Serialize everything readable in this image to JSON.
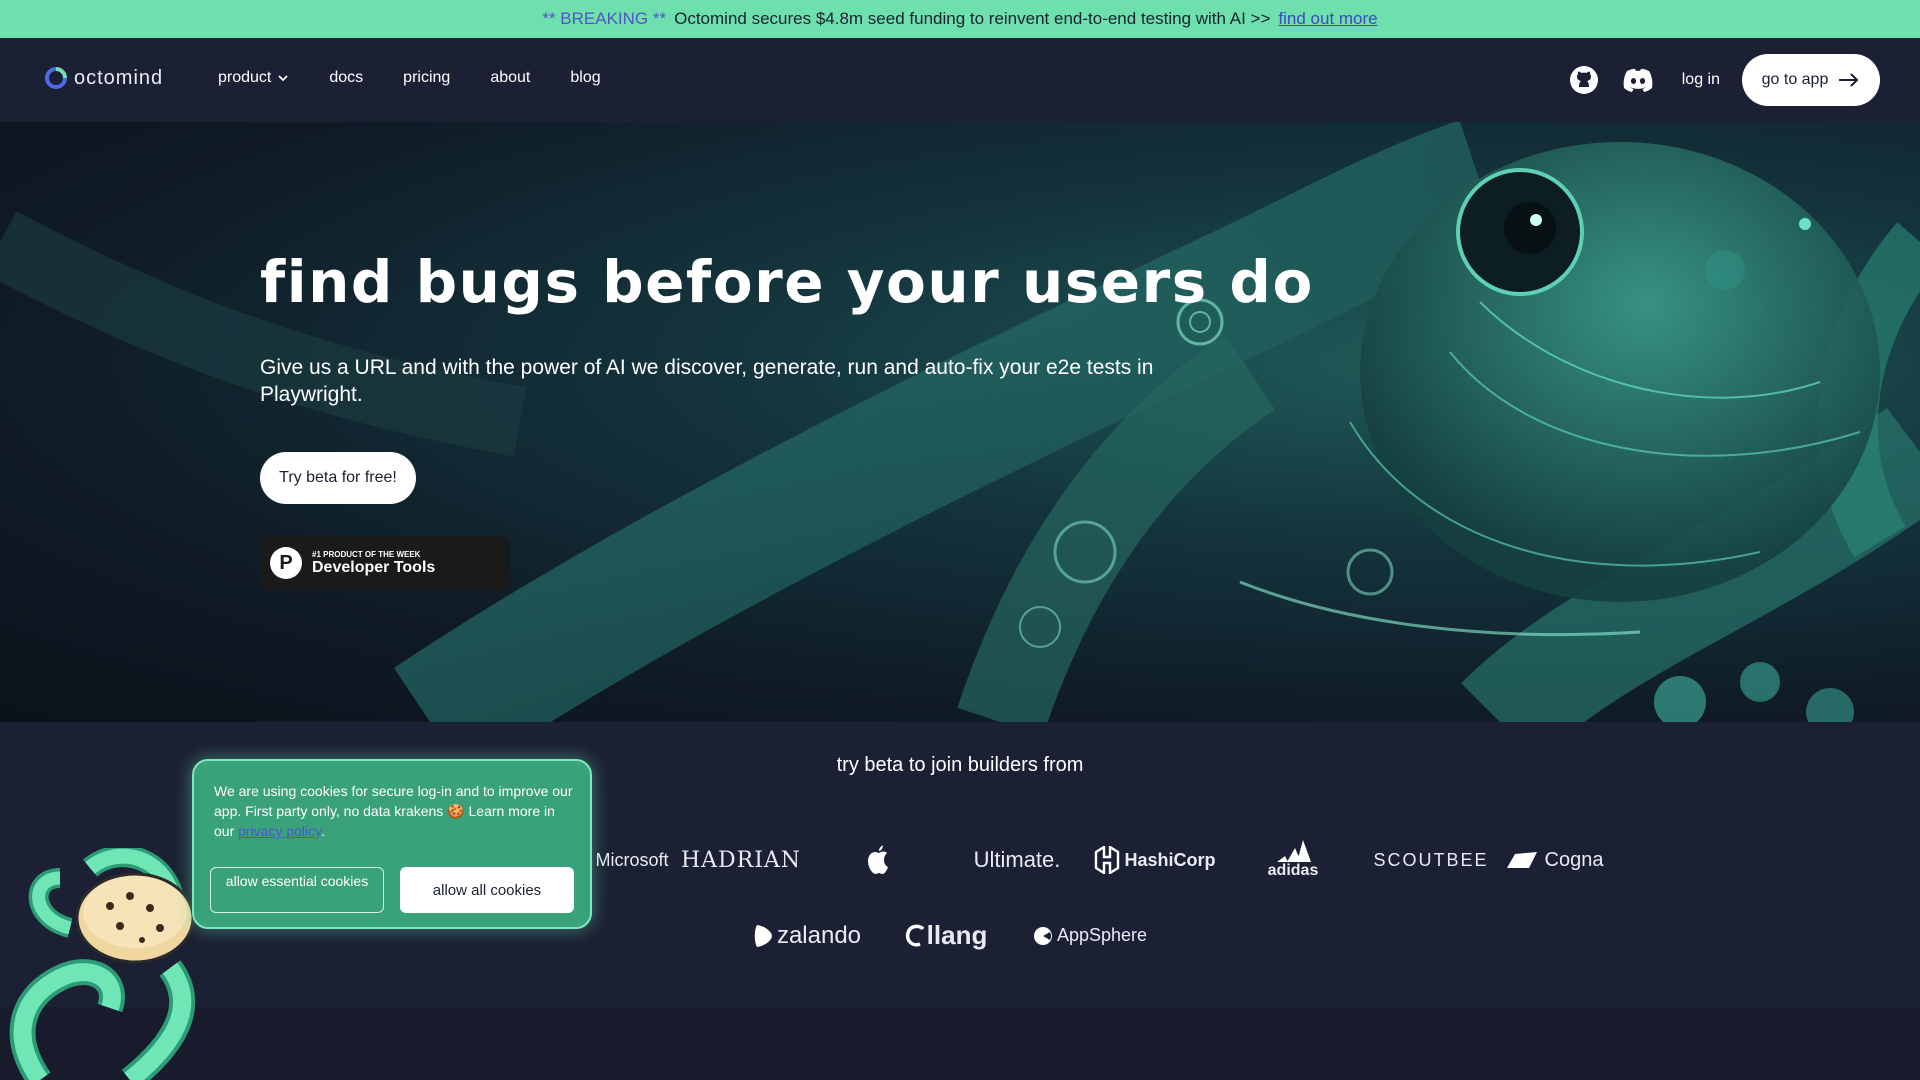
{
  "banner": {
    "tag": "** BREAKING **",
    "text": "Octomind secures $4.8m seed funding to reinvent end-to-end testing with AI >>",
    "link": "find out more"
  },
  "nav": {
    "logo": "octomind",
    "items": [
      "product",
      "docs",
      "pricing",
      "about",
      "blog"
    ],
    "login": "log in",
    "cta": "go to app",
    "icons": [
      "github-icon",
      "discord-icon",
      "arrow-right-icon",
      "chevron-down-icon"
    ]
  },
  "hero": {
    "title": "find bugs before your users do",
    "subtitle": "Give us a URL and with the power of AI we discover, generate, run and auto-fix your e2e tests in Playwright.",
    "cta": "Try beta for free!",
    "badge": {
      "logo": "P",
      "small": "#1 PRODUCT OF THE WEEK",
      "big": "Developer Tools"
    }
  },
  "builders": {
    "title": "try beta to join builders from",
    "row1": [
      "Microsoft",
      "HADRIAN",
      "",
      "Ultimate.",
      "HashiCorp",
      "adidas",
      "SCOUTBEE",
      "Cogna"
    ],
    "row2": [
      "zalando",
      "llang",
      "AppSphere"
    ]
  },
  "cookie": {
    "text_1": "We are using cookies for secure log-in and to improve our app.  First party only, no data krakens 🍪 Learn more in our ",
    "link": "privacy policy",
    "text_2": ".",
    "btn_essential": "allow essential cookies",
    "btn_all": "allow all cookies"
  },
  "colors": {
    "banner": "#6ee0ad",
    "nav": "#1b2034",
    "cookie": "#3aa27a",
    "link": "#3f49c3"
  }
}
